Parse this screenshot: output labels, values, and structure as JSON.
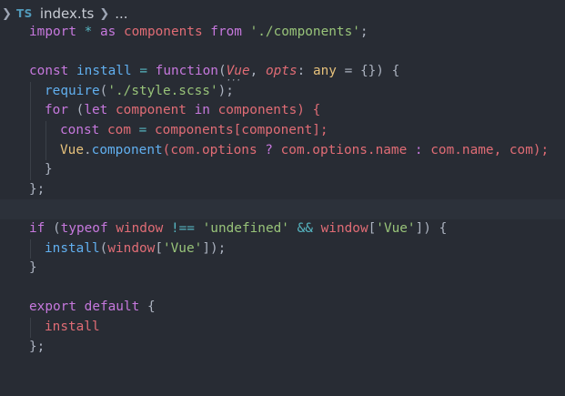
{
  "breadcrumb": {
    "lang_badge": "TS",
    "file": "index.ts",
    "more": "..."
  },
  "code": {
    "l1": {
      "t1": "import",
      "t2": " * ",
      "t3": "as",
      "t4": " components ",
      "t5": "from",
      "t6": " ",
      "t7": "'./components'",
      "t8": ";"
    },
    "l3": {
      "t1": "const",
      "t2": " install ",
      "t3": "=",
      "t4": " ",
      "t5": "function",
      "t6": "(",
      "t7": "Vue",
      "t8": ", ",
      "t9": "opts",
      "t10": ": ",
      "t11": "any",
      "t12": " = ",
      "t13": "{}",
      "t14": ") {"
    },
    "l4": {
      "t1": "require",
      "t2": "(",
      "t3": "'./style.scss'",
      "t4": ");"
    },
    "l5": {
      "t1": "for",
      "t2": " (",
      "t3": "let",
      "t4": " component ",
      "t5": "in",
      "t6": " components) {"
    },
    "l6": {
      "t1": "const",
      "t2": " com ",
      "t3": "=",
      "t4": " components[component];"
    },
    "l7": {
      "t1": "Vue",
      "t2": ".",
      "t3": "component",
      "t4": "(com.options ",
      "t5": "?",
      "t6": " com.options.name ",
      "t7": ":",
      "t8": " com.name, com);"
    },
    "l8": {
      "t1": "}"
    },
    "l9": {
      "t1": "};"
    },
    "l11": {
      "t1": "if",
      "t2": " (",
      "t3": "typeof",
      "t4": " ",
      "t5": "window",
      "t6": " ",
      "t7": "!==",
      "t8": " ",
      "t9": "'undefined'",
      "t10": " ",
      "t11": "&&",
      "t12": " ",
      "t13": "window",
      "t14": "[",
      "t15": "'Vue'",
      "t16": "]) {"
    },
    "l12": {
      "t1": "install",
      "t2": "(",
      "t3": "window",
      "t4": "[",
      "t5": "'Vue'",
      "t6": "]);"
    },
    "l13": {
      "t1": "}"
    },
    "l15": {
      "t1": "export",
      "t2": " ",
      "t3": "default",
      "t4": " {"
    },
    "l16": {
      "t1": "install"
    },
    "l17": {
      "t1": "};"
    }
  },
  "colors": {
    "background": "#282c34",
    "keyword": "#c678dd",
    "string": "#98c379",
    "function": "#61afef",
    "variable": "#e06c75",
    "type": "#e5c07b",
    "operator": "#56b6c2",
    "text": "#abb2bf"
  }
}
